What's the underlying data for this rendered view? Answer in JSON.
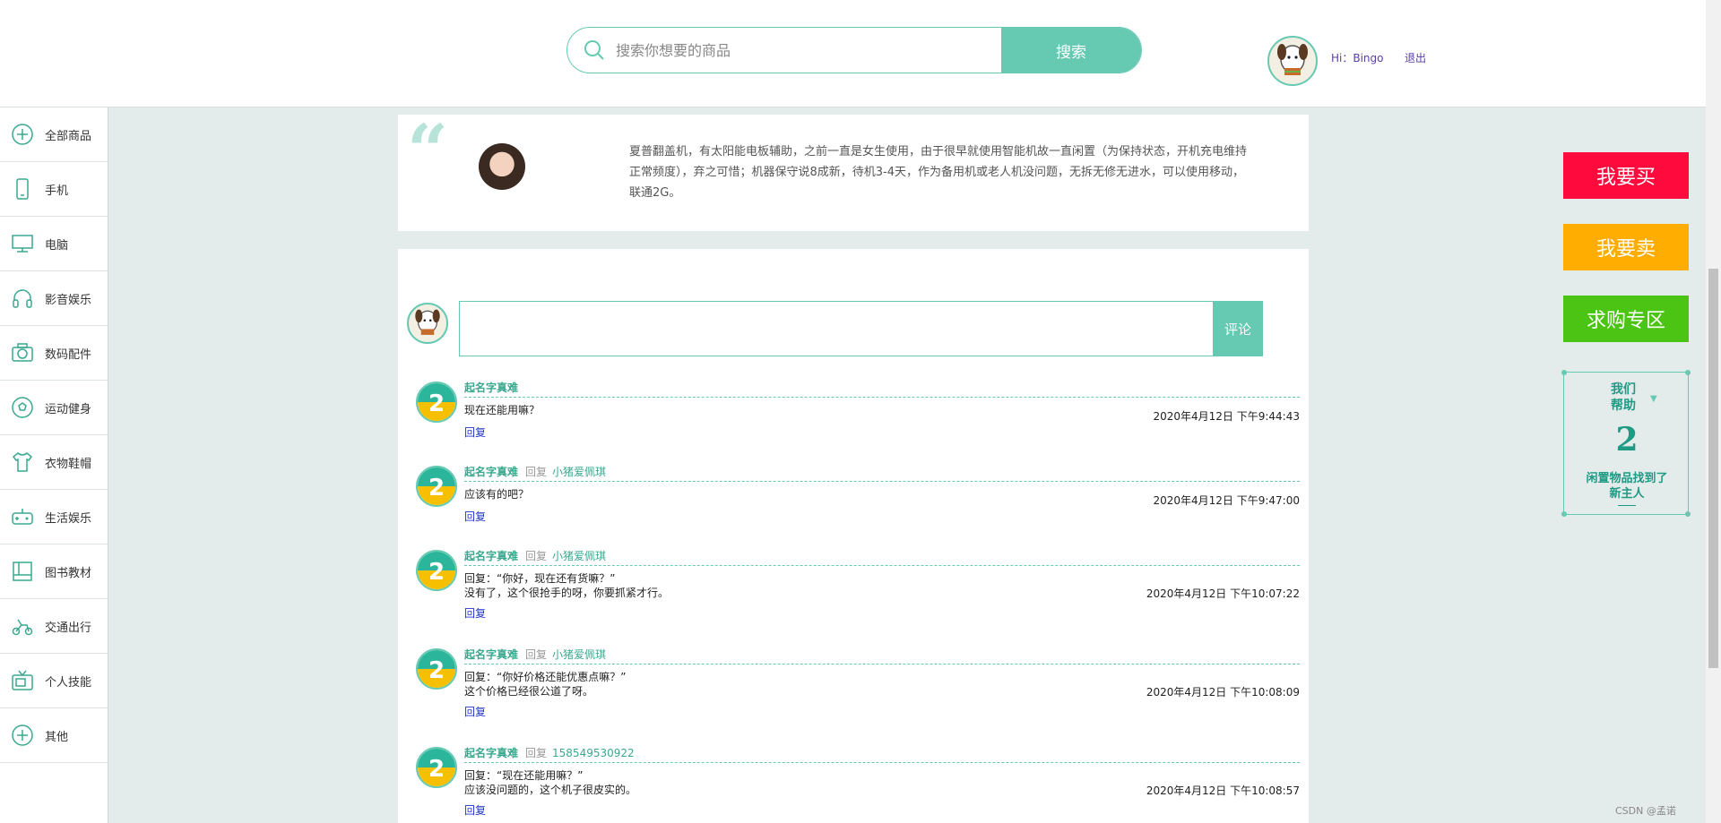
{
  "header": {
    "search_placeholder": "搜索你想要的商品",
    "search_button": "搜索",
    "greeting": "Hi：Bingo",
    "logout": "退出"
  },
  "sidebar": {
    "items": [
      {
        "label": "全部商品",
        "icon": "plus-circle-icon"
      },
      {
        "label": "手机",
        "icon": "phone-icon"
      },
      {
        "label": "电脑",
        "icon": "computer-icon"
      },
      {
        "label": "影音娱乐",
        "icon": "headphones-icon"
      },
      {
        "label": "数码配件",
        "icon": "camera-icon"
      },
      {
        "label": "运动健身",
        "icon": "soccer-ball-icon"
      },
      {
        "label": "衣物鞋帽",
        "icon": "shirt-icon"
      },
      {
        "label": "生活娱乐",
        "icon": "gamepad-icon"
      },
      {
        "label": "图书教材",
        "icon": "book-icon"
      },
      {
        "label": "交通出行",
        "icon": "scooter-icon"
      },
      {
        "label": "个人技能",
        "icon": "tv-icon"
      },
      {
        "label": "其他",
        "icon": "plus-circle-icon"
      }
    ]
  },
  "product": {
    "description": "夏普翻盖机，有太阳能电板辅助，之前一直是女生使用，由于很早就使用智能机故一直闲置（为保持状态，开机充电维持正常频度），弃之可惜；机器保守说8成新，待机3-4天，作为备用机或老人机没问题，无拆无修无进水，可以使用移动，联通2G。"
  },
  "comment_form": {
    "button": "评论"
  },
  "comments": [
    {
      "name": "起名字真难",
      "reply_word": "",
      "target": "",
      "line1": "现在还能用嘛？",
      "line2": "",
      "time": "2020年4月12日 下午9:44:43",
      "reply": "回复"
    },
    {
      "name": "起名字真难",
      "reply_word": "回复",
      "target": "小猪爱佩琪",
      "line1": "应该有的吧？",
      "line2": "",
      "time": "2020年4月12日 下午9:47:00",
      "reply": "回复"
    },
    {
      "name": "起名字真难",
      "reply_word": "回复",
      "target": "小猪爱佩琪",
      "line1": "回复：“你好，现在还有货嘛？”",
      "line2": "没有了，这个很抢手的呀，你要抓紧才行。",
      "time": "2020年4月12日 下午10:07:22",
      "reply": "回复"
    },
    {
      "name": "起名字真难",
      "reply_word": "回复",
      "target": "小猪爱佩琪",
      "line1": "回复：“你好价格还能优惠点嘛？”",
      "line2": "这个价格已经很公道了呀。",
      "time": "2020年4月12日 下午10:08:09",
      "reply": "回复"
    },
    {
      "name": "起名字真难",
      "reply_word": "回复",
      "target": "158549530922",
      "line1": "回复：“现在还能用嘛？”",
      "line2": "应该没问题的，这个机子很皮实的。",
      "time": "2020年4月12日 下午10:08:57",
      "reply": "回复"
    }
  ],
  "right_panel": {
    "buy": "我要买",
    "sell": "我要卖",
    "wanted": "求购专区",
    "help_title_1": "我们",
    "help_title_2": "帮助",
    "help_count": "2",
    "help_text_1": "闲置物品找到了",
    "help_text_2": "新主人",
    "colors": {
      "buy": "#ff0a3c",
      "sell": "#ffad00",
      "wanted": "#4cc413"
    }
  },
  "watermark": "CSDN @孟诺"
}
